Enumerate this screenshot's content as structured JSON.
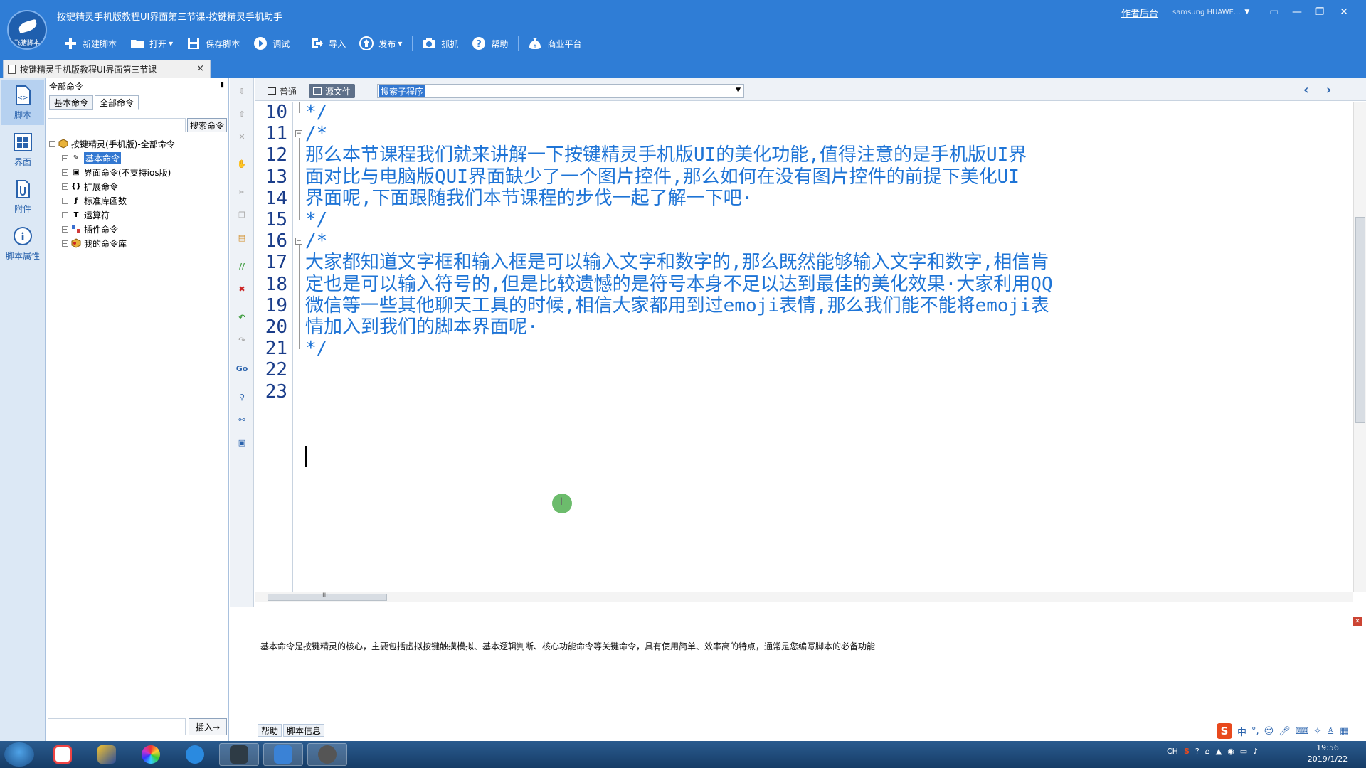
{
  "window": {
    "title": "按键精灵手机版教程UI界面第三节课-按键精灵手机助手",
    "logo_text": "飞猪脚本",
    "backend_link": "作者后台",
    "device": "samsung  HUAWE...",
    "ctrl_icons": [
      "skin-icon",
      "minimize-icon",
      "restore-icon",
      "close-icon"
    ]
  },
  "toolbar": {
    "new": "新建脚本",
    "open": "打开",
    "save": "保存脚本",
    "debug": "调试",
    "import": "导入",
    "publish": "发布",
    "capture": "抓抓",
    "help": "帮助",
    "store": "商业平台"
  },
  "doc_tab": {
    "label": "按键精灵手机版教程UI界面第三节课",
    "close": "×"
  },
  "nav": {
    "script": "脚本",
    "ui": "界面",
    "attachment": "附件",
    "props": "脚本属性"
  },
  "commands": {
    "header": "全部命令",
    "pin": "ª",
    "tabs": [
      "基本命令",
      "全部命令"
    ],
    "search_button": "搜索命令",
    "tree": {
      "root": "按键精灵(手机版)-全部命令",
      "items": [
        {
          "label": "基本命令",
          "icon": "pen-icon"
        },
        {
          "label": "界面命令(不支持ios版)",
          "icon": "window-icon"
        },
        {
          "label": "扩展命令",
          "icon": "braces-icon"
        },
        {
          "label": "标准库函数",
          "icon": "function-icon"
        },
        {
          "label": "运算符",
          "icon": "operator-icon"
        },
        {
          "label": "插件命令",
          "icon": "plugin-icon"
        },
        {
          "label": "我的命令库",
          "icon": "library-icon"
        }
      ]
    },
    "insert_button": "插入→"
  },
  "editor": {
    "modes": {
      "normal": "普通",
      "source": "源文件"
    },
    "sub_select": "搜索子程序",
    "lines": [
      {
        "n": "10",
        "text": "*/"
      },
      {
        "n": "11",
        "text": "/*"
      },
      {
        "n": "12",
        "text": "那么本节课程我们就来讲解一下按键精灵手机版UI的美化功能,值得注意的是手机版UI界"
      },
      {
        "n": "13",
        "text": "面对比与电脑版QUI界面缺少了一个图片控件,那么如何在没有图片控件的前提下美化UI"
      },
      {
        "n": "14",
        "text": "界面呢,下面跟随我们本节课程的步伐一起了解一下吧·"
      },
      {
        "n": "15",
        "text": "*/"
      },
      {
        "n": "16",
        "text": "/*"
      },
      {
        "n": "17",
        "text": "大家都知道文字框和输入框是可以输入文字和数字的,那么既然能够输入文字和数字,相信肯"
      },
      {
        "n": "18",
        "text": "定也是可以输入符号的,但是比较遗憾的是符号本身不足以达到最佳的美化效果·大家利用QQ"
      },
      {
        "n": "19",
        "text": "微信等一些其他聊天工具的时候,相信大家都用到过emoji表情,那么我们能不能将emoji表"
      },
      {
        "n": "20",
        "text": "情加入到我们的脚本界面呢·"
      },
      {
        "n": "21",
        "text": "*/"
      },
      {
        "n": "22",
        "text": ""
      },
      {
        "n": "23",
        "text": ""
      }
    ],
    "hscroll_grip": "III",
    "text_color": "#1e74d6"
  },
  "help": {
    "text": "基本命令是按键精灵的核心，主要包括虚拟按键触摸模拟、基本逻辑判断、核心功能命令等关键命令，具有使用简单、效率高的特点，通常是您编写脚本的必备功能",
    "tabs": [
      "帮助",
      "脚本信息"
    ]
  },
  "ime": {
    "logo": "S",
    "mode": "中"
  },
  "tray": {
    "lang": "CH"
  },
  "clock": {
    "time": "19:56",
    "date": "2019/1/22"
  },
  "colors": {
    "accent": "#2f7dd6",
    "selection": "#3378d1"
  }
}
